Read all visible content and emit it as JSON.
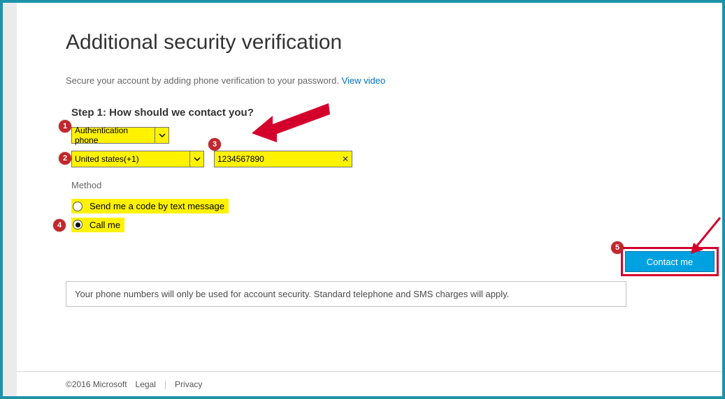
{
  "title": "Additional security verification",
  "subtitle_text": "Secure your account by adding phone verification to your password. ",
  "subtitle_link": "View video",
  "step_heading": "Step 1: How should we contact you?",
  "auth_select": "Authentication phone",
  "country_select": "United states(+1)",
  "phone_value": "1234567890",
  "method_label": "Method",
  "radio_text": "Send me a code by text message",
  "radio_call": "Call me",
  "notice": "Your phone numbers will only be used for account security. Standard telephone and SMS charges will apply.",
  "contact_btn": "Contact me",
  "footer_copyright": "©2016 Microsoft",
  "footer_legal": "Legal",
  "footer_privacy": "Privacy",
  "badges": {
    "b1": "1",
    "b2": "2",
    "b3": "3",
    "b4": "4",
    "b5": "5"
  }
}
